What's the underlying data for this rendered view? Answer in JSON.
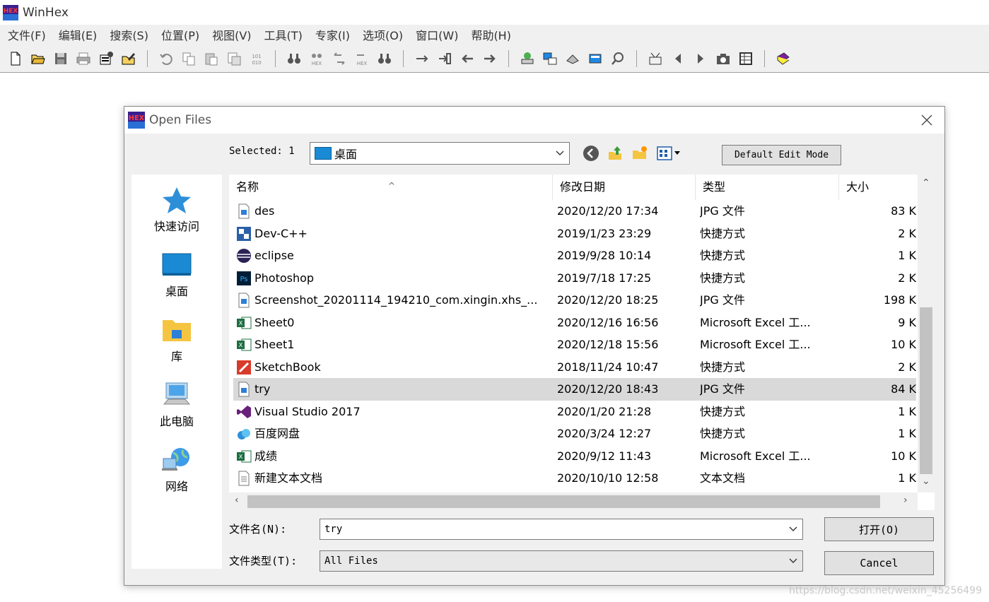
{
  "app": {
    "title": "WinHex"
  },
  "menu": [
    "文件(F)",
    "编辑(E)",
    "搜索(S)",
    "位置(P)",
    "视图(V)",
    "工具(T)",
    "专家(I)",
    "选项(O)",
    "窗口(W)",
    "帮助(H)"
  ],
  "dialog": {
    "title": "Open Files",
    "selected_label": "Selected: 1",
    "look_in": "桌面",
    "mode_button": "Default Edit Mode",
    "places": [
      "快速访问",
      "桌面",
      "库",
      "此电脑",
      "网络"
    ],
    "columns": [
      "名称",
      "修改日期",
      "类型",
      "大小"
    ],
    "files": [
      {
        "name": "des",
        "date": "2020/12/20 17:34",
        "type": "JPG 文件",
        "size": "83 K",
        "icon": "image-file-icon"
      },
      {
        "name": "Dev-C++",
        "date": "2019/1/23 23:29",
        "type": "快捷方式",
        "size": "2 K",
        "icon": "devcpp-shortcut-icon"
      },
      {
        "name": "eclipse",
        "date": "2019/9/28 10:14",
        "type": "快捷方式",
        "size": "1 K",
        "icon": "eclipse-shortcut-icon"
      },
      {
        "name": "Photoshop",
        "date": "2019/7/18 17:25",
        "type": "快捷方式",
        "size": "2 K",
        "icon": "photoshop-shortcut-icon"
      },
      {
        "name": "Screenshot_20201114_194210_com.xingin.xhs_...",
        "date": "2020/12/20 18:25",
        "type": "JPG 文件",
        "size": "198 K",
        "icon": "image-file-icon"
      },
      {
        "name": "Sheet0",
        "date": "2020/12/16 16:56",
        "type": "Microsoft Excel 工...",
        "size": "9 K",
        "icon": "excel-file-icon"
      },
      {
        "name": "Sheet1",
        "date": "2020/12/18 15:56",
        "type": "Microsoft Excel 工...",
        "size": "10 K",
        "icon": "excel-file-icon"
      },
      {
        "name": "SketchBook",
        "date": "2018/11/24 10:47",
        "type": "快捷方式",
        "size": "2 K",
        "icon": "sketchbook-shortcut-icon"
      },
      {
        "name": "try",
        "date": "2020/12/20 18:43",
        "type": "JPG 文件",
        "size": "84 K",
        "icon": "image-file-icon",
        "selected": true
      },
      {
        "name": "Visual Studio 2017",
        "date": "2020/1/20 21:28",
        "type": "快捷方式",
        "size": "1 K",
        "icon": "visual-studio-shortcut-icon"
      },
      {
        "name": "百度网盘",
        "date": "2020/3/24 12:27",
        "type": "快捷方式",
        "size": "1 K",
        "icon": "baidu-netdisk-shortcut-icon"
      },
      {
        "name": "成绩",
        "date": "2020/9/12 11:43",
        "type": "Microsoft Excel 工...",
        "size": "10 K",
        "icon": "excel-file-icon"
      },
      {
        "name": "新建文本文档",
        "date": "2020/10/10 12:58",
        "type": "文本文档",
        "size": "1 K",
        "icon": "text-file-icon"
      }
    ],
    "filename_label": "文件名(N):",
    "filename_value": "try",
    "filetype_label": "文件类型(T):",
    "filetype_value": "All Files",
    "open_button": "打开(O)",
    "cancel_button": "Cancel"
  },
  "watermark": "https://blog.csdn.net/weixin_45256499",
  "colors": {
    "accent_blue": "#1a8ad4",
    "selected_row": "#d9d9d9",
    "window_bg": "#f0f0f0"
  }
}
